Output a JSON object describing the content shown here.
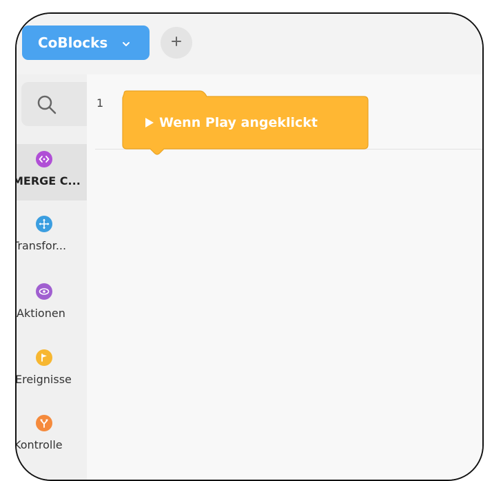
{
  "topbar": {
    "project_tab_label": "CoBlocks",
    "project_tab_color": "#4aa3f0",
    "add_tab_symbol": "+"
  },
  "sidebar": {
    "search_icon": "search-icon",
    "categories": [
      {
        "label": "MERGE C...",
        "icon": "code-brackets-icon",
        "color": "#b04fd6",
        "active": true
      },
      {
        "label": "Transfor...",
        "icon": "move-arrows-icon",
        "color": "#3b9ee0",
        "active": false
      },
      {
        "label": "Aktionen",
        "icon": "eye-icon",
        "color": "#a05fd0",
        "active": false
      },
      {
        "label": "Ereignisse",
        "icon": "flag-icon",
        "color": "#f7b731",
        "active": false
      },
      {
        "label": "Kontrolle",
        "icon": "fork-arrows-icon",
        "color": "#f58a3c",
        "active": false
      }
    ]
  },
  "workspace": {
    "line_number": "1",
    "event_block": {
      "label": "Wenn Play angeklickt",
      "icon": "play-icon",
      "color": "#ffb733"
    }
  }
}
